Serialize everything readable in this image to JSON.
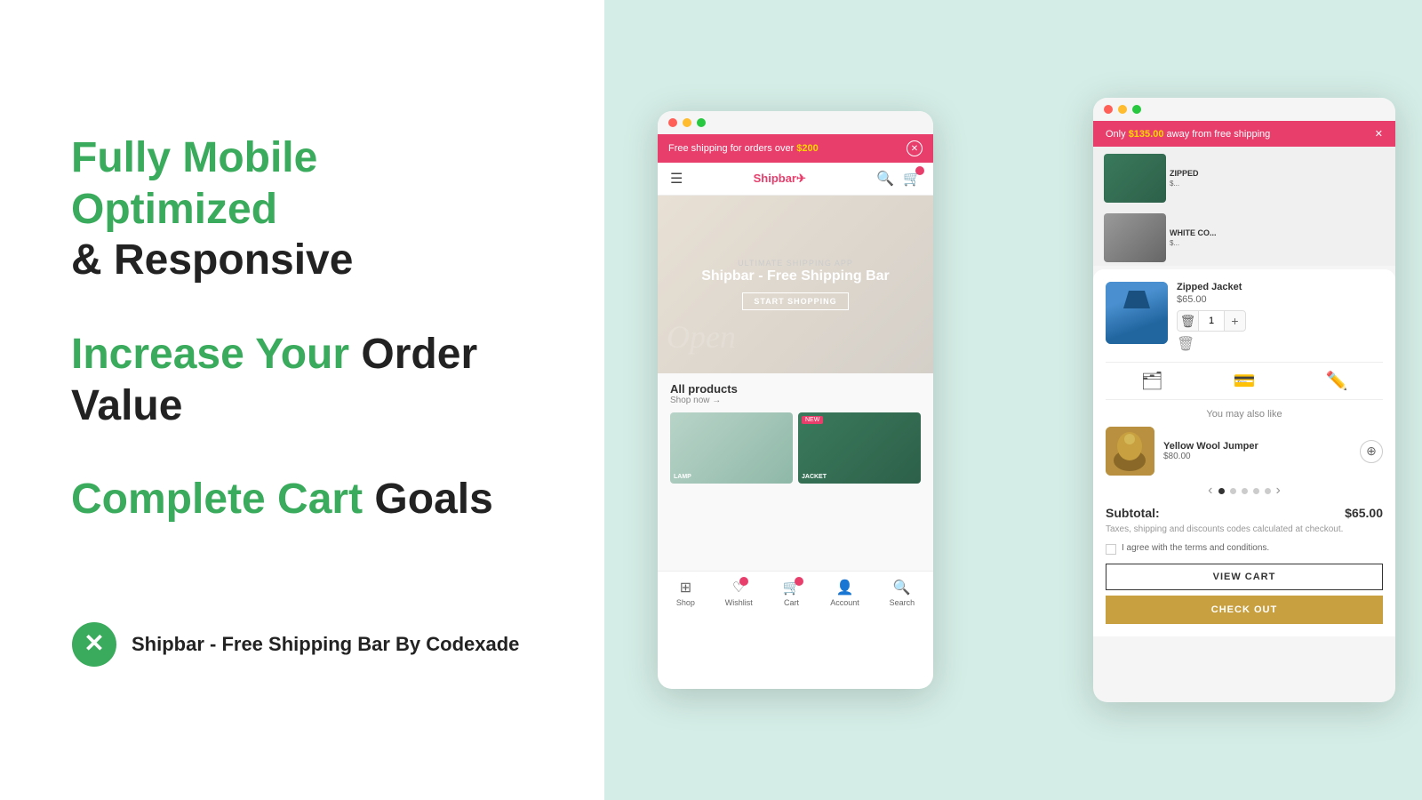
{
  "left": {
    "headline1_green": "Fully Mobile Optimized",
    "headline1_black": "& Responsive",
    "headline2_green": "Increase Your",
    "headline2_black": "Order Value",
    "headline3_green": "Complete Cart",
    "headline3_black": "Goals",
    "brand_name": "Shipbar - Free Shipping Bar By Codexade"
  },
  "device_left": {
    "shipping_bar": "Free shipping for orders over ",
    "shipping_amount": "$200",
    "logo": "Shipbar✈",
    "hero_subtitle": "Ultimate shipping app",
    "hero_title": "Shipbar - Free Shipping Bar",
    "hero_btn": "START SHOPPING",
    "products_header": "All products",
    "products_sub": "Shop now →",
    "nav_shop": "Shop",
    "nav_wishlist": "Wishlist",
    "nav_cart": "Cart",
    "nav_account": "Account",
    "nav_search": "Search"
  },
  "device_right": {
    "shipping_bar": "Only ",
    "shipping_amount": "$135.00",
    "shipping_suffix": " away from free shipping",
    "item_name": "Zipped Jacket",
    "item_price": "$65.00",
    "qty": "1",
    "also_like_title": "You may also like",
    "also_like_name": "Yellow Wool Jumper",
    "also_like_price": "$80.00",
    "subtotal_label": "Subtotal:",
    "subtotal_val": "$65.00",
    "tax_note": "Taxes, shipping and discounts codes calculated at checkout.",
    "terms_text": "I agree with the terms and conditions.",
    "view_cart_btn": "VIEW CART",
    "checkout_btn": "CHECK OUT"
  },
  "colors": {
    "green": "#3aab5c",
    "pink": "#e83e6c",
    "gold": "#c8a040"
  }
}
